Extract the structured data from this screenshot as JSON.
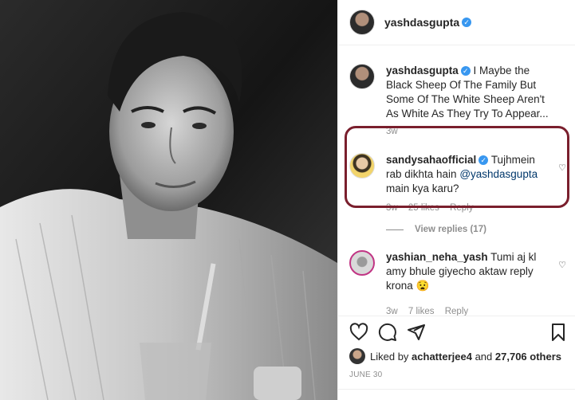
{
  "post": {
    "author": "yashdasgupta",
    "photo_alt": "Black and white portrait"
  },
  "caption": {
    "author": "yashdasgupta",
    "text": "I Maybe the Black Sheep Of The Family But Some Of The White Sheep Aren't As White As They Try To Appear...",
    "time": "3w"
  },
  "comments": [
    {
      "author": "sandysahaofficial",
      "text_before": "Tujhmein rab dikhta hain ",
      "mention": "@yashdasgupta",
      "text_after": " main kya karu?",
      "time": "3w",
      "likes": "25 likes",
      "reply": "Reply",
      "view_replies": "View replies (17)"
    },
    {
      "author": "yashian_neha_yash",
      "text": "Tumi aj kl amy bhule giyecho aktaw reply krona 😧",
      "time": "3w",
      "likes": "7 likes",
      "reply": "Reply"
    }
  ],
  "likes_line": {
    "prefix": "Liked by ",
    "user": "achatterjee4",
    "middle": " and ",
    "others": "27,706 others"
  },
  "date": "JUNE 30",
  "icons": [
    "heart-icon",
    "comment-icon",
    "share-icon",
    "bookmark-icon"
  ],
  "colors": {
    "highlight": "#7a1f2d",
    "verified": "#3897f0",
    "meta": "#8e8e8e"
  }
}
